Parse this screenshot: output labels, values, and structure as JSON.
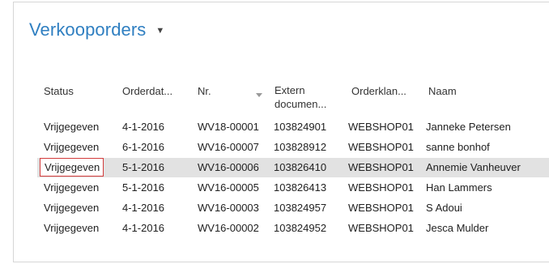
{
  "page": {
    "title": "Verkooporders",
    "title_menu_icon": "chevron-down-icon"
  },
  "table": {
    "columns": [
      {
        "key": "status",
        "label": "Status"
      },
      {
        "key": "order_date",
        "label": "Orderdat..."
      },
      {
        "key": "nr",
        "label": "Nr."
      },
      {
        "key": "external_doc",
        "label_line1": "Extern",
        "label_line2": "documen..."
      },
      {
        "key": "customer",
        "label": "Orderklan..."
      },
      {
        "key": "name",
        "label": "Naam"
      }
    ],
    "sorted_column": "nr",
    "sort_direction": "descending",
    "rows": [
      {
        "status": "Vrijgegeven",
        "order_date": "4-1-2016",
        "nr": "WV18-00001",
        "external_doc": "103824901",
        "customer": "WEBSHOP01",
        "name": "Janneke Petersen"
      },
      {
        "status": "Vrijgegeven",
        "order_date": "6-1-2016",
        "nr": "WV16-00007",
        "external_doc": "103828912",
        "customer": "WEBSHOP01",
        "name": "sanne bonhof"
      },
      {
        "status": "Vrijgegeven",
        "order_date": "5-1-2016",
        "nr": "WV16-00006",
        "external_doc": "103826410",
        "customer": "WEBSHOP01",
        "name": "Annemie Vanheuver"
      },
      {
        "status": "Vrijgegeven",
        "order_date": "5-1-2016",
        "nr": "WV16-00005",
        "external_doc": "103826413",
        "customer": "WEBSHOP01",
        "name": "Han Lammers"
      },
      {
        "status": "Vrijgegeven",
        "order_date": "4-1-2016",
        "nr": "WV16-00003",
        "external_doc": "103824957",
        "customer": "WEBSHOP01",
        "name": "S Adoui"
      },
      {
        "status": "Vrijgegeven",
        "order_date": "4-1-2016",
        "nr": "WV16-00002",
        "external_doc": "103824952",
        "customer": "WEBSHOP01",
        "name": "Jesca Mulder"
      }
    ],
    "selected_row_index": 2
  },
  "colors": {
    "title": "#2f7fc1",
    "selected_row": "#e2e2e2",
    "focus_border": "#d23b3b"
  }
}
